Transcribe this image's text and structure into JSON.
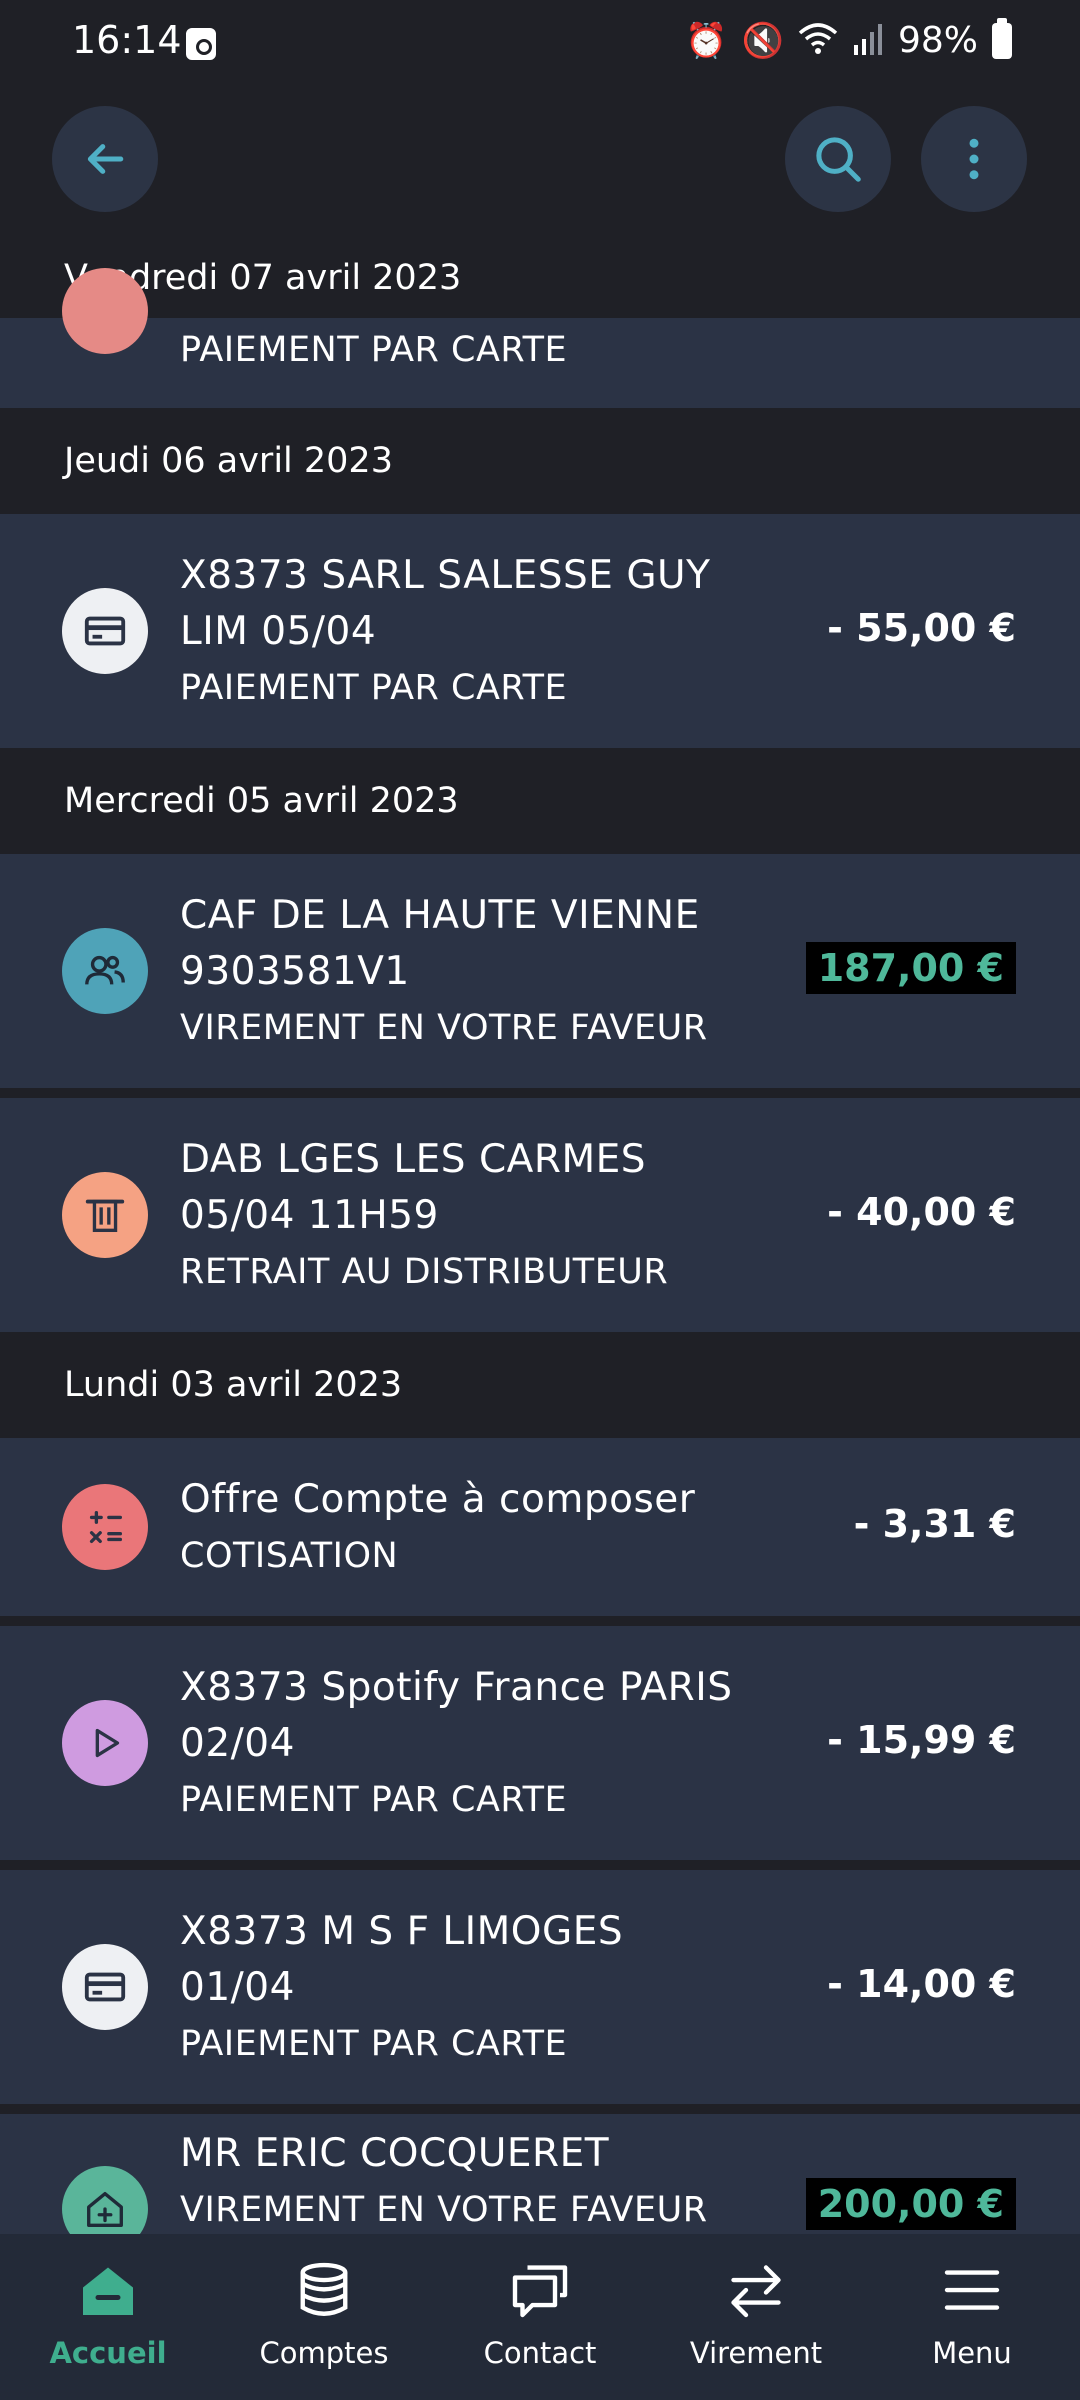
{
  "status_bar": {
    "time": "16:14",
    "battery": "98%"
  },
  "colors": {
    "background": "#1f2026",
    "row": "#2b3345",
    "accent_green": "#3fae8e",
    "accent_blue": "#4fb0c6"
  },
  "top_bar": {
    "back_icon": "arrow-left-icon",
    "search_icon": "search-icon",
    "more_icon": "more-vertical-icon"
  },
  "groups": [
    {
      "date": "Vendredi 07 avril 2023",
      "items": [
        {
          "title": "",
          "type": "PAIEMENT PAR CARTE",
          "amount": ""
        }
      ]
    },
    {
      "date": "Jeudi 06 avril 2023",
      "items": [
        {
          "title_line1": "X8373 SARL SALESSE GUY",
          "title_line2": "LIM 05/04",
          "type": "PAIEMENT PAR CARTE",
          "amount": "- 55,00 €",
          "icon": "card-icon"
        }
      ]
    },
    {
      "date": "Mercredi 05 avril 2023",
      "items": [
        {
          "title_line1": "CAF DE LA HAUTE VIENNE",
          "title_line2": "9303581V1",
          "type": "VIREMENT EN VOTRE FAVEUR",
          "amount": "187,00 €",
          "icon": "people-icon"
        },
        {
          "title_line1": "DAB LGES LES CARMES",
          "title_line2": "05/04 11H59",
          "type": "RETRAIT AU DISTRIBUTEUR",
          "amount": "- 40,00 €",
          "icon": "atm-icon"
        }
      ]
    },
    {
      "date": "Lundi 03 avril 2023",
      "items": [
        {
          "title_line1": "Offre Compte à composer",
          "type": "COTISATION",
          "amount": "- 3,31 €",
          "icon": "calculator-icon"
        },
        {
          "title_line1": "X8373 Spotify France PARIS",
          "title_line2": "02/04",
          "type": "PAIEMENT PAR CARTE",
          "amount": "- 15,99 €",
          "icon": "play-icon"
        },
        {
          "title_line1": "X8373 M S F LIMOGES",
          "title_line2": "01/04",
          "type": "PAIEMENT PAR CARTE",
          "amount": "- 14,00 €",
          "icon": "card-icon"
        },
        {
          "title_line1": "MR ERIC COCQUERET",
          "type": "VIREMENT EN VOTRE FAVEUR",
          "amount": "200,00 €",
          "icon": "house-plus-icon"
        }
      ]
    }
  ],
  "bottom_nav": [
    {
      "label": "Accueil",
      "icon": "home-icon",
      "active": true
    },
    {
      "label": "Comptes",
      "icon": "database-icon"
    },
    {
      "label": "Contact",
      "icon": "chat-icon"
    },
    {
      "label": "Virement",
      "icon": "transfer-icon"
    },
    {
      "label": "Menu",
      "icon": "hamburger-icon"
    }
  ]
}
